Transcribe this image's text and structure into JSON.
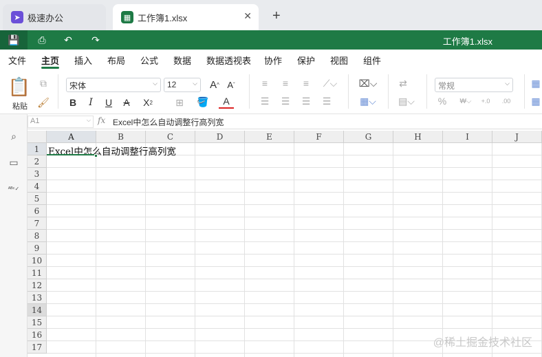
{
  "tabs": [
    {
      "label": "极速办公",
      "icon": "rocket-icon",
      "color": "#6b4fd8"
    },
    {
      "label": "工作簿1.xlsx",
      "icon": "spreadsheet-icon",
      "color": "#1e7a45"
    }
  ],
  "quickbar": {
    "doc_title": "工作簿1.xlsx"
  },
  "menu": [
    "文件",
    "主页",
    "插入",
    "布局",
    "公式",
    "数据",
    "数据透视表",
    "协作",
    "保护",
    "视图",
    "组件"
  ],
  "ribbon": {
    "paste_label": "粘贴",
    "font_name": "宋体",
    "font_size": "12",
    "number_format": "常规"
  },
  "formula_bar": {
    "name_box": "A1",
    "fx": "fx",
    "content": "Excel中怎么自动调整行高列宽"
  },
  "columns": [
    "A",
    "B",
    "C",
    "D",
    "E",
    "F",
    "G",
    "H",
    "I",
    "J"
  ],
  "rows": [
    "1",
    "2",
    "3",
    "4",
    "5",
    "6",
    "7",
    "8",
    "9",
    "10",
    "11",
    "12",
    "13",
    "14",
    "15",
    "16",
    "17"
  ],
  "cells": {
    "A1": "Excel中怎么自动调整行高列宽"
  },
  "watermark": "@稀土掘金技术社区",
  "accent": "#1e7a45"
}
